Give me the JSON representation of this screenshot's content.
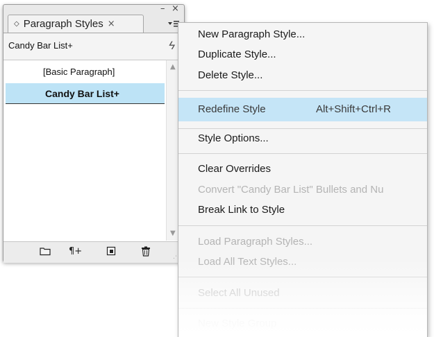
{
  "panel": {
    "title": "Paragraph Styles",
    "tab_close": "×",
    "minimize": "–",
    "close": "×",
    "current_style": "Candy Bar List+",
    "styles": [
      {
        "label": "[Basic Paragraph]"
      },
      {
        "label": "Candy Bar List+"
      }
    ],
    "selected_style": "Candy Bar List+"
  },
  "menu": {
    "items": [
      {
        "label": "New Paragraph Style...",
        "enabled": true
      },
      {
        "label": "Duplicate Style...",
        "enabled": true
      },
      {
        "label": "Delete Style...",
        "enabled": true
      },
      {
        "label": "Redefine Style",
        "shortcut": "Alt+Shift+Ctrl+R",
        "enabled": true,
        "highlighted": true
      },
      {
        "label": "Style Options...",
        "enabled": true
      },
      {
        "label": "Clear Overrides",
        "enabled": true
      },
      {
        "label": "Convert \"Candy Bar List\" Bullets and Nu",
        "enabled": false
      },
      {
        "label": "Break Link to Style",
        "enabled": true
      },
      {
        "label": "Load Paragraph Styles...",
        "enabled": false
      },
      {
        "label": "Load All Text Styles...",
        "enabled": false
      },
      {
        "label": "Select All Unused",
        "enabled": false
      },
      {
        "label": "New Style Group",
        "enabled": false
      }
    ]
  },
  "colors": {
    "selection": "#bde3f6",
    "menu_highlight": "#c5e5f7",
    "disabled_text": "#b4b4b4"
  },
  "icons": {
    "bottom_toolbar": [
      "folder-icon",
      "clear-overrides-icon",
      "new-style-icon",
      "trash-icon"
    ]
  }
}
